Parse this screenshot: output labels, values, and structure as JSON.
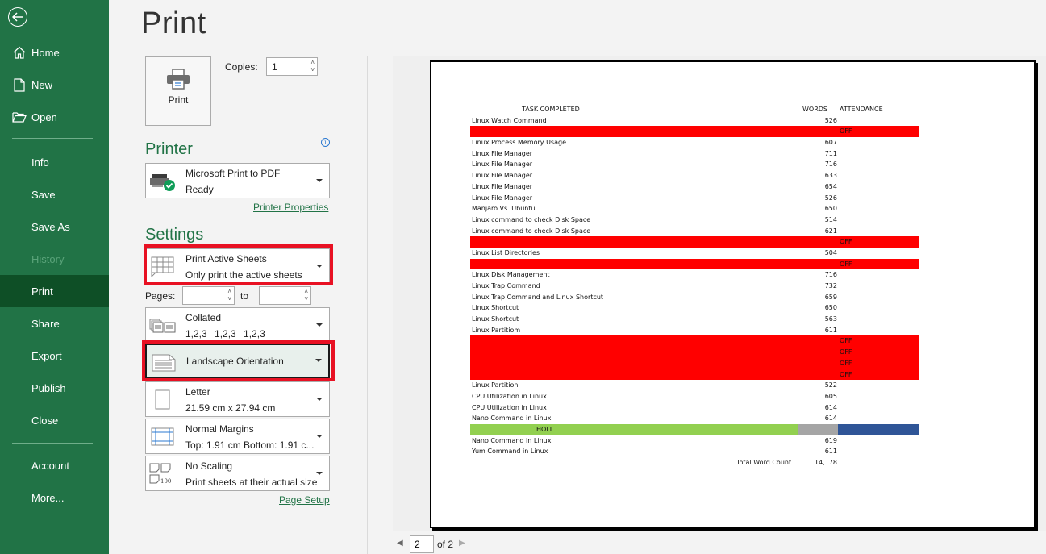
{
  "sidebar": {
    "back_label": "Back",
    "items": [
      {
        "label": "Home",
        "icon": "home-icon"
      },
      {
        "label": "New",
        "icon": "new-file-icon"
      },
      {
        "label": "Open",
        "icon": "folder-open-icon"
      },
      {
        "label": "Info"
      },
      {
        "label": "Save"
      },
      {
        "label": "Save As"
      },
      {
        "label": "History",
        "disabled": true
      },
      {
        "label": "Print",
        "active": true
      },
      {
        "label": "Share"
      },
      {
        "label": "Export"
      },
      {
        "label": "Publish"
      },
      {
        "label": "Close"
      },
      {
        "label": "Account"
      },
      {
        "label": "More..."
      }
    ],
    "colors": {
      "bg": "#217346",
      "active": "#0e4f26"
    }
  },
  "main": {
    "title": "Print",
    "print_button": "Print",
    "copies_label": "Copies:",
    "copies_value": "1",
    "printer_heading": "Printer",
    "printer": {
      "name": "Microsoft Print to PDF",
      "status": "Ready"
    },
    "printer_properties_link": "Printer Properties",
    "settings_heading": "Settings",
    "settings": {
      "what": {
        "title": "Print Active Sheets",
        "subtitle": "Only print the active sheets"
      },
      "pages_label": "Pages:",
      "pages_from": "",
      "pages_to_label": "to",
      "pages_to": "",
      "collation": {
        "title": "Collated",
        "subtitle": "1,2,3    1,2,3    1,2,3"
      },
      "orientation": {
        "title": "Landscape Orientation"
      },
      "paper": {
        "title": "Letter",
        "subtitle": "21.59 cm x 27.94 cm"
      },
      "margins": {
        "title": "Normal Margins",
        "subtitle": "Top: 1.91 cm Bottom: 1.91 c..."
      },
      "scaling": {
        "title": "No Scaling",
        "subtitle": "Print sheets at their actual size"
      }
    },
    "page_setup_link": "Page Setup",
    "highlight_color": "#e81123"
  },
  "preview": {
    "headers": {
      "task": "TASK COMPLETED",
      "words": "WORDS",
      "attendance": "ATTENDANCE"
    },
    "rows": [
      {
        "task": "Linux Watch Command",
        "words": "526",
        "att": ""
      },
      {
        "task": "",
        "words": "",
        "att": "OFF",
        "type": "off"
      },
      {
        "task": "Linux Process Memory Usage",
        "words": "607",
        "att": ""
      },
      {
        "task": "Linux File Manager",
        "words": "711",
        "att": ""
      },
      {
        "task": "Linux File Manager",
        "words": "716",
        "att": ""
      },
      {
        "task": "Linux File Manager",
        "words": "633",
        "att": ""
      },
      {
        "task": "Linux File Manager",
        "words": "654",
        "att": ""
      },
      {
        "task": "Linux File Manager",
        "words": "526",
        "att": ""
      },
      {
        "task": "Manjaro Vs. Ubuntu",
        "words": "650",
        "att": ""
      },
      {
        "task": "Linux command to check Disk Space",
        "words": "514",
        "att": ""
      },
      {
        "task": "Linux command to check Disk Space",
        "words": "621",
        "att": ""
      },
      {
        "task": "",
        "words": "",
        "att": "OFF",
        "type": "off"
      },
      {
        "task": "Linux List Directories",
        "words": "504",
        "att": ""
      },
      {
        "task": "",
        "words": "",
        "att": "OFF",
        "type": "off"
      },
      {
        "task": "Linux Disk Management",
        "words": "716",
        "att": ""
      },
      {
        "task": "Linux Trap Command",
        "words": "732",
        "att": ""
      },
      {
        "task": "Linux Trap Command and Linux Shortcut",
        "words": "659",
        "att": ""
      },
      {
        "task": "Linux Shortcut",
        "words": "650",
        "att": ""
      },
      {
        "task": "Linux Shortcut",
        "words": "563",
        "att": ""
      },
      {
        "task": "Linux Partitiom",
        "words": "611",
        "att": ""
      },
      {
        "task": "",
        "words": "",
        "att": "OFF",
        "type": "off"
      },
      {
        "task": "",
        "words": "",
        "att": "OFF",
        "type": "off"
      },
      {
        "task": "",
        "words": "",
        "att": "OFF",
        "type": "off"
      },
      {
        "task": "",
        "words": "",
        "att": "OFF",
        "type": "off"
      },
      {
        "task": "Linux Partition",
        "words": "522",
        "att": ""
      },
      {
        "task": "CPU Utilization in Linux",
        "words": "605",
        "att": ""
      },
      {
        "task": "CPU Utilization in Linux",
        "words": "614",
        "att": ""
      },
      {
        "task": "Nano Command in Linux",
        "words": "614",
        "att": ""
      },
      {
        "task": "HOLI",
        "words": "",
        "att": "",
        "type": "holi"
      },
      {
        "task": "Nano Command in Linux",
        "words": "619",
        "att": ""
      },
      {
        "task": "Yum Command in Linux",
        "words": "611",
        "att": ""
      },
      {
        "task": "Total Word Count",
        "words": "14,178",
        "att": "",
        "type": "total"
      }
    ],
    "colors": {
      "off": "#ff0000",
      "holi_green": "#92d050",
      "holi_gray": "#a5a5a5",
      "holi_blue": "#2f5597"
    },
    "pager": {
      "current": "2",
      "of_label": "of 2"
    }
  }
}
